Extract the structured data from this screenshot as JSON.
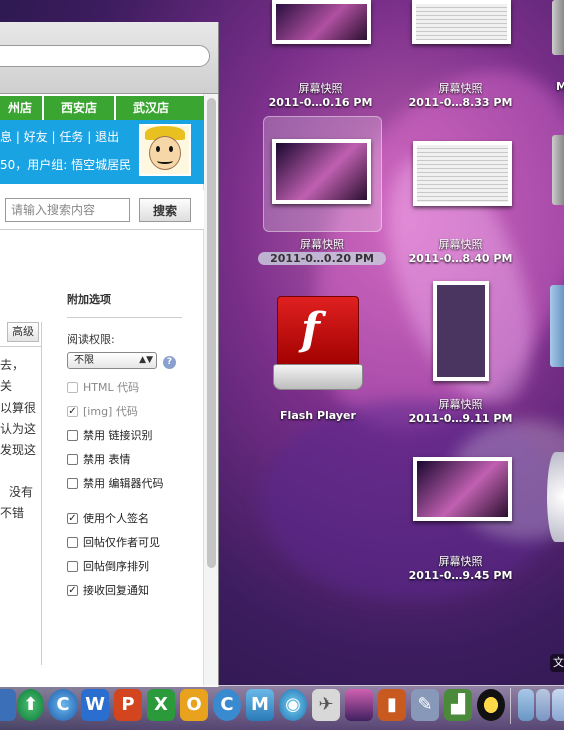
{
  "browser": {
    "store_tabs": [
      "州店",
      "西安店",
      "武汉店"
    ],
    "user_links": [
      "息",
      "好友",
      "任务",
      "退出"
    ],
    "user_info": "50，用户组: 悟空城居民",
    "search": {
      "placeholder": "请输入搜索内容",
      "button": "搜索"
    },
    "editor": {
      "advanced_button": "高级",
      "lines": [
        "去，",
        "关",
        "以算很",
        "认为这",
        "发现这",
        "没有",
        "不错"
      ]
    },
    "extra_options": {
      "title": "附加选项",
      "read_permission_label": "阅读权限:",
      "read_permission_value": "不限",
      "options": [
        {
          "label": "HTML 代码",
          "checked": false,
          "disabled": true
        },
        {
          "label": "[img] 代码",
          "checked": true,
          "disabled": true
        },
        {
          "label": "禁用 链接识别",
          "checked": false,
          "disabled": false
        },
        {
          "label": "禁用 表情",
          "checked": false,
          "disabled": false
        },
        {
          "label": "禁用 编辑器代码",
          "checked": false,
          "disabled": false
        },
        {
          "label": "使用个人签名",
          "checked": true,
          "disabled": false
        },
        {
          "label": "回帖仅作者可见",
          "checked": false,
          "disabled": false
        },
        {
          "label": "回帖倒序排列",
          "checked": false,
          "disabled": false
        },
        {
          "label": "接收回复通知",
          "checked": true,
          "disabled": false
        }
      ]
    }
  },
  "desktop": {
    "icons": [
      {
        "line1": "屏幕快照",
        "line2": "2011-0…0.16 PM"
      },
      {
        "line1": "屏幕快照",
        "line2": "2011-0…8.33 PM"
      },
      {
        "line1": "屏幕快照",
        "line2": "2011-0…0.20 PM"
      },
      {
        "line1": "屏幕快照",
        "line2": "2011-0…8.40 PM"
      },
      {
        "line1": "",
        "line2": "Flash Player"
      },
      {
        "line1": "屏幕快照",
        "line2": "2011-0…9.11 PM"
      },
      {
        "line1": "屏幕快照",
        "line2": "2011-0…9.45 PM"
      }
    ],
    "edge_label_top": "M",
    "edge_label_bottom": "文"
  },
  "dock": {
    "icons": [
      "fs",
      "wc",
      "qc",
      "w",
      "p",
      "x",
      "o",
      "c",
      "msn",
      "globe",
      "sat",
      "slides",
      "pres",
      "pen",
      "chart",
      "qq",
      "folder",
      "apps",
      "docs"
    ]
  },
  "colors": {
    "store_tab_bg": "#3aa531",
    "user_bar_bg": "#1aa3e3"
  }
}
